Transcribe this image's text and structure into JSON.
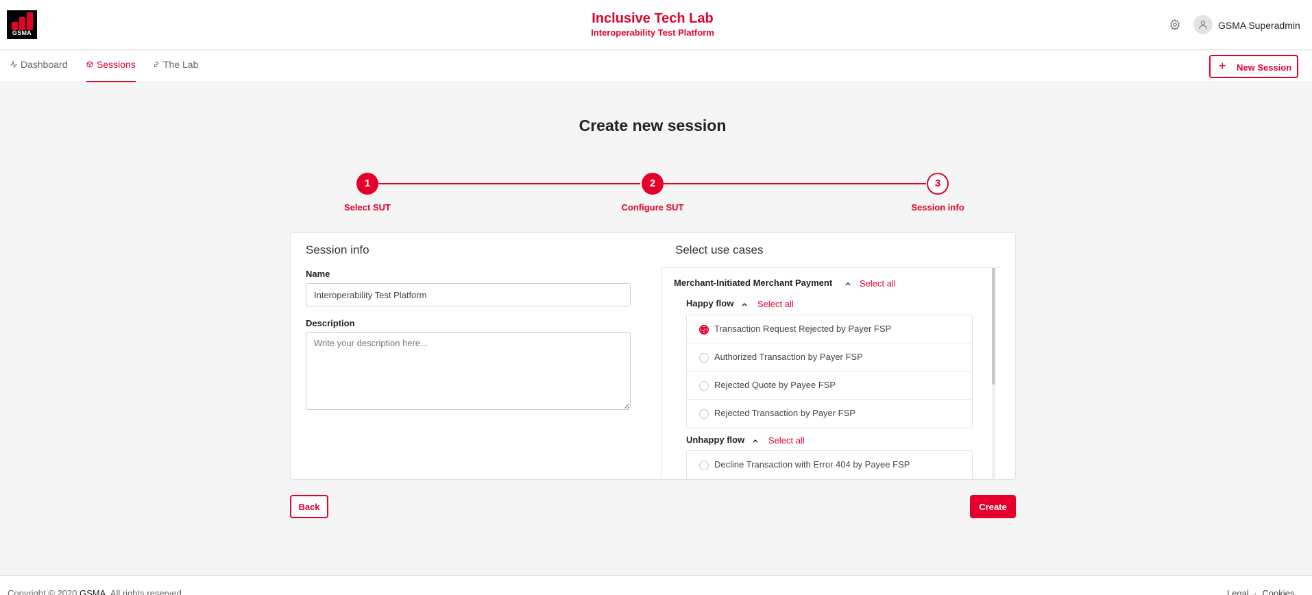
{
  "header": {
    "logo_text": "GSMA",
    "title": "Inclusive Tech Lab",
    "subtitle": "Interoperability Test Platform",
    "settings_icon": "gear-icon",
    "user_icon": "user-icon",
    "user_name": "GSMA Superadmin"
  },
  "nav": {
    "items": [
      {
        "label": "Dashboard",
        "icon": "activity-icon",
        "active": false
      },
      {
        "label": "Sessions",
        "icon": "cube-icon",
        "active": true
      },
      {
        "label": "The Lab",
        "icon": "link-icon",
        "active": false
      }
    ],
    "new_session_label": "New Session"
  },
  "page": {
    "title": "Create new session"
  },
  "steps": [
    {
      "number": "1",
      "label": "Select SUT",
      "state": "done"
    },
    {
      "number": "2",
      "label": "Configure SUT",
      "state": "done"
    },
    {
      "number": "3",
      "label": "Session info",
      "state": "current"
    }
  ],
  "form": {
    "section_title": "Session info",
    "name_label": "Name",
    "name_value": "Interoperability Test Platform",
    "description_label": "Description",
    "description_placeholder": "Write your description here..."
  },
  "use_cases": {
    "section_title": "Select use cases",
    "group": {
      "name": "Merchant-Initiated Merchant Payment",
      "select_all": "Select all",
      "happy_flow": {
        "name": "Happy flow",
        "select_all": "Select all",
        "cases": [
          {
            "label": "Transaction Request Rejected by Payer FSP",
            "checked": true
          },
          {
            "label": "Authorized Transaction by Payer FSP",
            "checked": false
          },
          {
            "label": "Rejected Quote by Payee FSP",
            "checked": false
          },
          {
            "label": "Rejected Transaction by Payer FSP",
            "checked": false
          }
        ]
      },
      "unhappy_flow": {
        "name": "Unhappy flow",
        "select_all": "Select all",
        "cases": [
          {
            "label": "Decline Transaction with Error 404 by Payee FSP",
            "checked": false
          }
        ]
      }
    }
  },
  "actions": {
    "back_label": "Back",
    "create_label": "Create"
  },
  "footer": {
    "copyright_prefix": "Copyright © 2020",
    "copyright_brand": "GSMA.",
    "copyright_suffix": "All rights reserved",
    "links": [
      "Legal",
      "Cookies"
    ],
    "separator": "·"
  },
  "colors": {
    "accent": "#e4002b",
    "background": "#f5f5f5"
  }
}
